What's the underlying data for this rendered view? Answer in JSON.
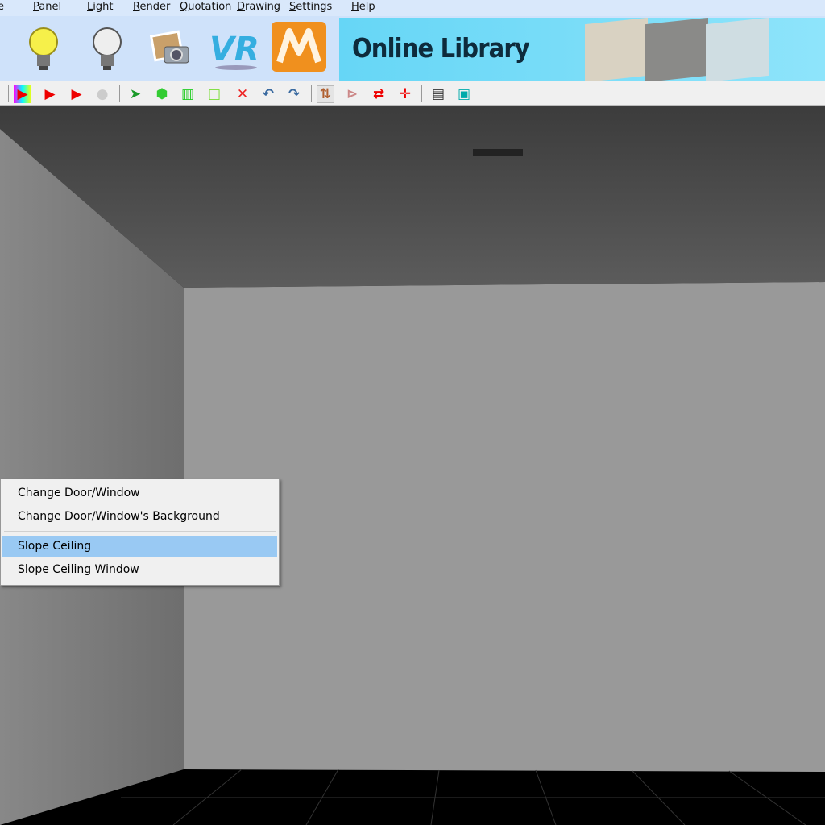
{
  "menu": {
    "items": [
      {
        "label": "e",
        "u": ""
      },
      {
        "label": "anel",
        "u": "P"
      },
      {
        "label": "ight",
        "u": "L"
      },
      {
        "label": "ender",
        "u": "R"
      },
      {
        "label": "uotation",
        "u": "Q"
      },
      {
        "label": "rawing",
        "u": "D"
      },
      {
        "label": "ettings",
        "u": "S"
      },
      {
        "label": "elp",
        "u": "H"
      }
    ]
  },
  "iconbar": {
    "icons": [
      "light-on-icon",
      "light-off-icon",
      "photo-camera-icon",
      "vr-logo-icon",
      "m-logo-icon"
    ],
    "vr_text": "VR",
    "banner_title": "Online Library"
  },
  "toolbar": {
    "icons": [
      "color-render-icon",
      "render-arrow-icon",
      "render-layers-icon",
      "sphere-icon",
      "select-arrow-icon",
      "cube-icon",
      "wall-icon",
      "room-size-icon",
      "delete-select-icon",
      "undo-icon",
      "redo-icon",
      "flip-vertical-icon",
      "mirror-icon",
      "swap-icon",
      "move-icon",
      "note-icon",
      "window-layout-icon"
    ]
  },
  "context_menu": {
    "items": [
      {
        "label": "Change Door/Window",
        "highlighted": false
      },
      {
        "label": "Change Door/Window's Background",
        "highlighted": false
      },
      {
        "label": "Slope Ceiling",
        "highlighted": true
      },
      {
        "label": "Slope Ceiling Window",
        "highlighted": false
      }
    ]
  }
}
